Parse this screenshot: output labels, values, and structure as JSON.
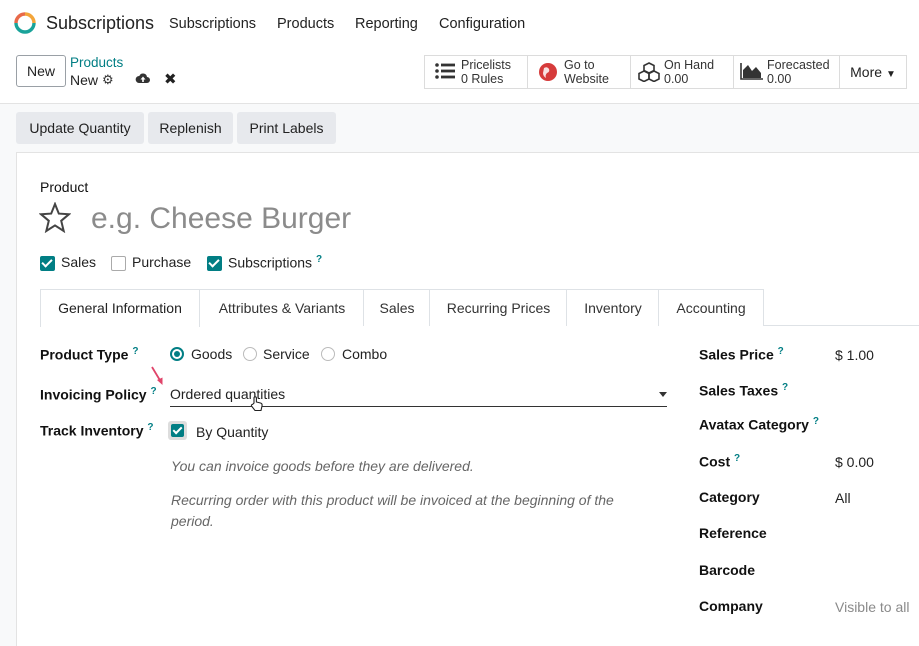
{
  "app": {
    "name": "Subscriptions",
    "menu": [
      "Subscriptions",
      "Products",
      "Reporting",
      "Configuration"
    ]
  },
  "control": {
    "new_label": "New",
    "breadcrumb_parent": "Products",
    "breadcrumb_current": "New",
    "stats": [
      {
        "icon": "list-icon",
        "line1": "Pricelists",
        "line2": "0 Rules"
      },
      {
        "icon": "globe-icon",
        "line1": "Go to",
        "line2": "Website"
      },
      {
        "icon": "cubes-icon",
        "line1": "On Hand",
        "line2": "0.00"
      },
      {
        "icon": "area-chart-icon",
        "line1": "Forecasted",
        "line2": "0.00"
      }
    ],
    "more_label": "More"
  },
  "actions": [
    "Update Quantity",
    "Replenish",
    "Print Labels"
  ],
  "form": {
    "product_label": "Product",
    "name_placeholder": "e.g. Cheese Burger",
    "checkboxes": [
      {
        "label": "Sales",
        "checked": true
      },
      {
        "label": "Purchase",
        "checked": false
      },
      {
        "label": "Subscriptions",
        "checked": true,
        "help": "?"
      }
    ],
    "tabs": [
      "General Information",
      "Attributes & Variants",
      "Sales",
      "Recurring Prices",
      "Inventory",
      "Accounting"
    ],
    "product_type": {
      "label": "Product Type",
      "help": "?",
      "options": [
        "Goods",
        "Service",
        "Combo"
      ],
      "selected": "Goods"
    },
    "invoicing_policy": {
      "label": "Invoicing Policy",
      "help": "?",
      "value": "Ordered quantities"
    },
    "track_inventory": {
      "label": "Track Inventory",
      "help": "?",
      "value": "By Quantity",
      "checked": true
    },
    "hints": [
      "You can invoice goods before they are delivered.",
      "Recurring order with this product will be invoiced at the beginning of the period."
    ],
    "right_fields": [
      {
        "label": "Sales Price",
        "help": "?",
        "value": "$ 1.00"
      },
      {
        "label": "Sales Taxes",
        "help": "?",
        "value": ""
      },
      {
        "label": "Avatax Category",
        "help": "?",
        "value": ""
      },
      {
        "label": "Cost",
        "help": "?",
        "value": "$ 0.00"
      },
      {
        "label": "Category",
        "help": "",
        "value": "All"
      },
      {
        "label": "Reference",
        "help": "",
        "value": ""
      },
      {
        "label": "Barcode",
        "help": "",
        "value": ""
      },
      {
        "label": "Company",
        "help": "",
        "value": "Visible to all"
      }
    ]
  },
  "colors": {
    "accent": "#017e84",
    "arrow": "#e0446a"
  }
}
